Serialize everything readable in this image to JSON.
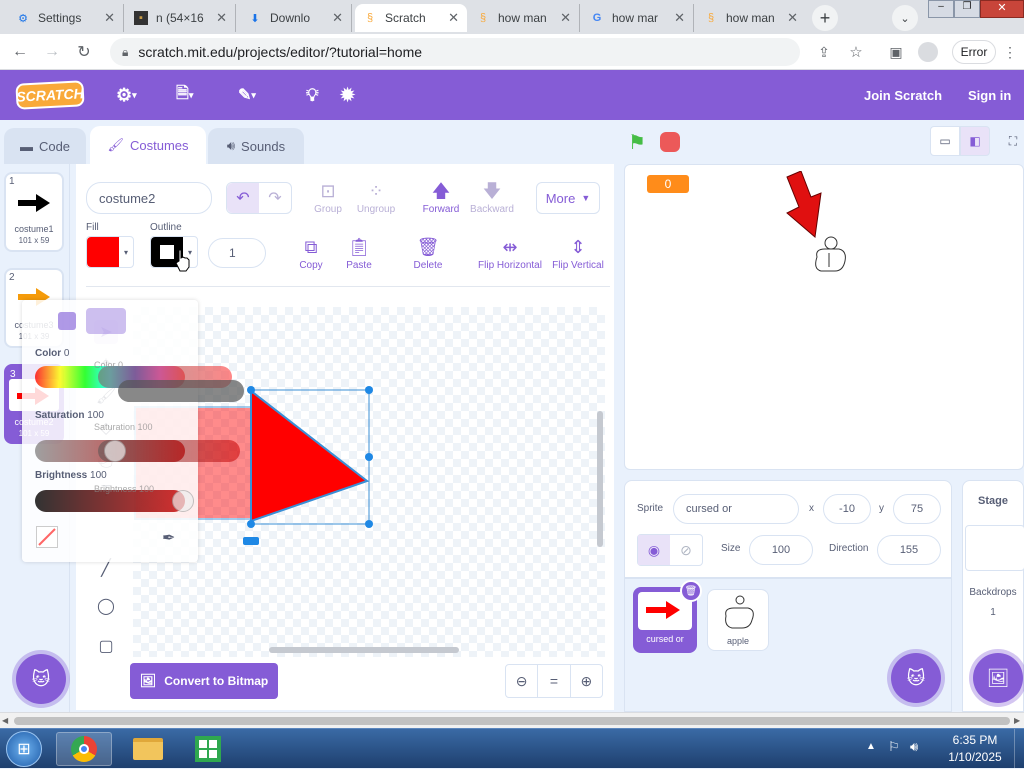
{
  "browser": {
    "tabs": [
      {
        "title": "Settings",
        "icon": "gear-icon"
      },
      {
        "title": "n (54×16",
        "icon": "image-icon"
      },
      {
        "title": "Downlo",
        "icon": "download-icon"
      },
      {
        "title": "Scratch",
        "icon": "scratch-icon"
      },
      {
        "title": "how man",
        "icon": "scratch-icon"
      },
      {
        "title": "how mar",
        "icon": "google-icon"
      },
      {
        "title": "how man",
        "icon": "scratch-icon"
      }
    ],
    "url": "scratch.mit.edu/projects/editor/?tutorial=home",
    "error_label": "Error"
  },
  "menu": {
    "logo": "SCRATCH",
    "join": "Join Scratch",
    "signin": "Sign in"
  },
  "editor_tabs": {
    "code": "Code",
    "costumes": "Costumes",
    "sounds": "Sounds"
  },
  "costumes": [
    {
      "num": "1",
      "name": "costume1",
      "size": "101 x 59",
      "color": "#000000"
    },
    {
      "num": "2",
      "name": "costume3",
      "size": "101 x 39",
      "color": "#f59b0a"
    },
    {
      "num": "3",
      "name": "costume2",
      "size": "101 x 59",
      "color": "#ff0000"
    }
  ],
  "paint": {
    "costume_name": "costume2",
    "group": "Group",
    "ungroup": "Ungroup",
    "forward": "Forward",
    "backward": "Backward",
    "more": "More",
    "fill_label": "Fill",
    "outline_label": "Outline",
    "fill_color": "#ff0000",
    "outline_color": "#000000",
    "outline_width": "1",
    "copy": "Copy",
    "paste": "Paste",
    "delete": "Delete",
    "flip_h": "Flip Horizontal",
    "flip_v": "Flip Vertical",
    "convert": "Convert to Bitmap",
    "zoom_eq": "="
  },
  "colorpicker": {
    "color_label": "Color",
    "color_value": "0",
    "saturation_label": "Saturation",
    "saturation_value": "100",
    "brightness_label": "Brightness",
    "brightness_value": "100",
    "ghost_color_label": "Color",
    "ghost_color_value": "0",
    "ghost_saturation_label": "Saturation",
    "ghost_saturation_value": "100",
    "ghost_brightness_label": "Brightness",
    "ghost_brightness_value": "100"
  },
  "stage": {
    "score": "0"
  },
  "sprite": {
    "label": "Sprite",
    "name": "cursed or",
    "x_label": "x",
    "x": "-10",
    "y_label": "y",
    "y": "75",
    "size_label": "Size",
    "size": "100",
    "direction_label": "Direction",
    "direction": "155"
  },
  "sprites": [
    {
      "name": "cursed or"
    },
    {
      "name": "apple"
    }
  ],
  "stagepanel": {
    "title": "Stage",
    "backdrops_label": "Backdrops",
    "backdrops_count": "1"
  },
  "taskbar": {
    "time": "6:35 PM",
    "date": "1/10/2025"
  }
}
